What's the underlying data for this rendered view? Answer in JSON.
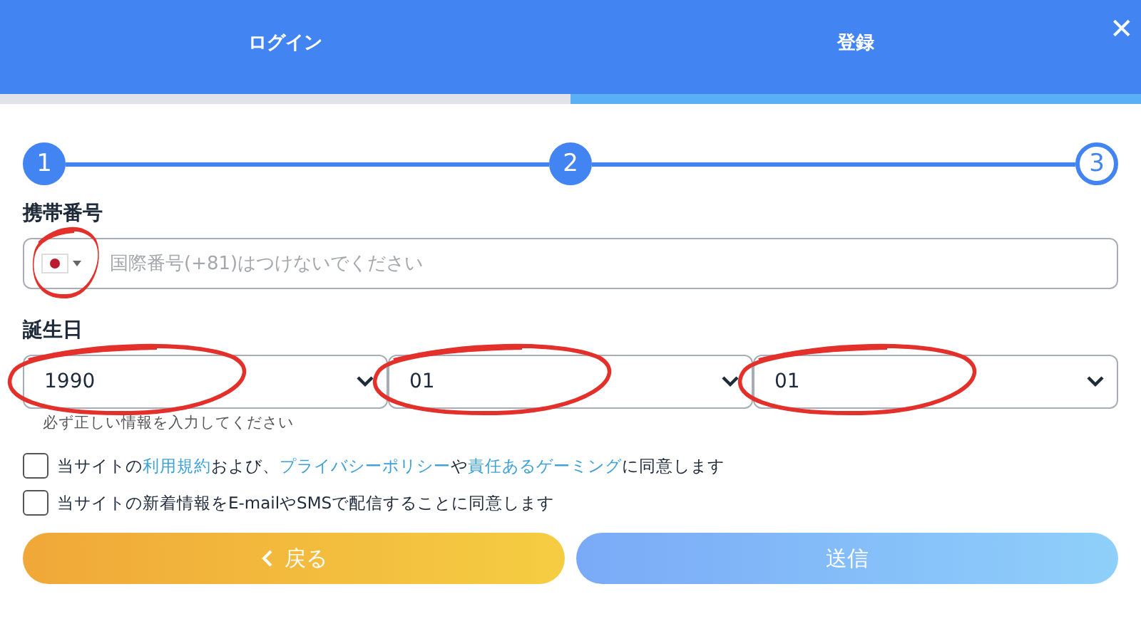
{
  "tabs": [
    {
      "label": "ログイン",
      "selected": false
    },
    {
      "label": "登録",
      "selected": true
    }
  ],
  "close": "✕",
  "steps": [
    {
      "label": "1",
      "filled": true
    },
    {
      "label": "2",
      "filled": true
    },
    {
      "label": "3",
      "filled": false
    }
  ],
  "phone": {
    "label": "携帯番号",
    "placeholder": "国際番号(+81)はつけないでください",
    "circled": true
  },
  "birthday": {
    "label": "誕生日",
    "selects": [
      {
        "value": "1990",
        "circled": true
      },
      {
        "value": "01",
        "circled": true
      },
      {
        "value": "01",
        "circled": true
      }
    ],
    "hint": "必ず正しい情報を入力してください"
  },
  "agreements": [
    {
      "checked": false,
      "parts": [
        {
          "kind": "text",
          "text": "当サイトの"
        },
        {
          "kind": "link",
          "text": "利用規約"
        },
        {
          "kind": "text",
          "text": "および、"
        },
        {
          "kind": "link",
          "text": "プライバシーポリシー"
        },
        {
          "kind": "text",
          "text": "や"
        },
        {
          "kind": "link",
          "text": "責任あるゲーミング"
        },
        {
          "kind": "text",
          "text": "に同意します"
        }
      ]
    },
    {
      "checked": false,
      "parts": [
        {
          "kind": "text",
          "text": "当サイトの新着情報をE-mailやSMSで配信することに同意します"
        }
      ]
    }
  ],
  "buttons": [
    {
      "kind": "back",
      "label": "戻る"
    },
    {
      "kind": "submit",
      "label": "送信",
      "disabled": true
    }
  ]
}
